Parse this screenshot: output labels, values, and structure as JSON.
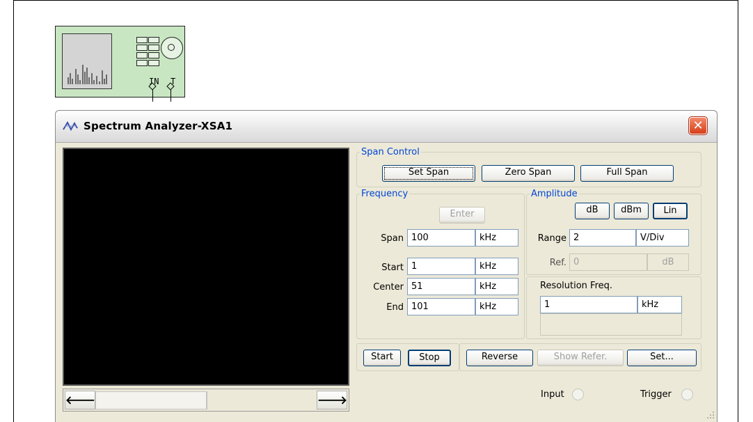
{
  "window": {
    "title": "Spectrum Analyzer-XSA1",
    "close_glyph": "✕"
  },
  "instrument_icon": {
    "pin_in": "IN",
    "pin_t": "T"
  },
  "scrollbar": {
    "left_arrow": "🡐",
    "right_arrow": "🡒"
  },
  "span_control": {
    "legend": "Span Control",
    "set_span": "Set Span",
    "zero_span": "Zero Span",
    "full_span": "Full Span"
  },
  "frequency": {
    "legend": "Frequency",
    "enter": "Enter",
    "span_label": "Span",
    "span_value": "100",
    "span_unit": "kHz",
    "start_label": "Start",
    "start_value": "1",
    "start_unit": "kHz",
    "center_label": "Center",
    "center_value": "51",
    "center_unit": "kHz",
    "end_label": "End",
    "end_value": "101",
    "end_unit": "kHz"
  },
  "amplitude": {
    "legend": "Amplitude",
    "db": "dB",
    "dbm": "dBm",
    "lin": "Lin",
    "range_label": "Range",
    "range_value": "2",
    "range_unit": "V/Div",
    "ref_label": "Ref.",
    "ref_value": "0",
    "ref_unit": "dB"
  },
  "resolution": {
    "label": "Resolution Freq.",
    "value": "1",
    "unit": "kHz"
  },
  "controls": {
    "start": "Start",
    "stop": "Stop",
    "reverse": "Reverse",
    "show_refer": "Show Refer.",
    "set": "Set..."
  },
  "indicators": {
    "input": "Input",
    "trigger": "Trigger"
  }
}
